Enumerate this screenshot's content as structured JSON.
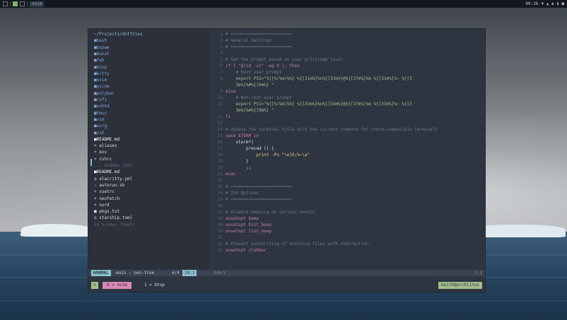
{
  "topbar": {
    "title": "nvim",
    "clock": "00:26",
    "tray": "▼ ▲ ◆ ▮ ■"
  },
  "tree": [
    {
      "text": "~/Projects/dotfiles",
      "cls": "root"
    },
    {
      "text": "  ■bash",
      "cls": "dir"
    },
    {
      "text": "  ■bspwm",
      "cls": "dir"
    },
    {
      "text": "  ■dunst",
      "cls": "dir"
    },
    {
      "text": "  ■feh",
      "cls": "dir"
    },
    {
      "text": "  ■htop",
      "cls": "dir"
    },
    {
      "text": "  ■kitty",
      "cls": "dir"
    },
    {
      "text": "  ■nvim",
      "cls": "dir"
    },
    {
      "text": "  ■picom",
      "cls": "dir"
    },
    {
      "text": "  ■polybar",
      "cls": "dir"
    },
    {
      "text": "  ■rofi",
      "cls": "dir"
    },
    {
      "text": "  ■sxhkd",
      "cls": "dir"
    },
    {
      "text": "  ■tmux",
      "cls": "dir"
    },
    {
      "text": "  ■vim",
      "cls": "dir"
    },
    {
      "text": "  ■xorg",
      "cls": "dir"
    },
    {
      "text": "  ■zsh",
      "cls": "dir"
    },
    {
      "text": "    ■README.md",
      "cls": "hl"
    },
    {
      "text": "    + aliases",
      "cls": "file"
    },
    {
      "text": "    + env",
      "cls": "file"
    },
    {
      "text": "    + zshrc",
      "cls": "file"
    },
    {
      "text": "  ... hidden (ok)",
      "cls": "dim"
    },
    {
      "text": "  ■README.md",
      "cls": "hl"
    },
    {
      "text": "  ◎ alacritty.yml",
      "cls": "file"
    },
    {
      "text": "  ◦ autorun.sh",
      "cls": "file"
    },
    {
      "text": "  + xsetrc",
      "cls": "file"
    },
    {
      "text": "  + neofetch",
      "cls": "file"
    },
    {
      "text": "  + nord",
      "cls": "file"
    },
    {
      "text": "  ■ pkgs.txt",
      "cls": "file"
    },
    {
      "text": "  ◎ starship.toml",
      "cls": "file"
    },
    {
      "text": "  14 hidden (toml)",
      "cls": "dim"
    }
  ],
  "code": [
    {
      "n": "1",
      "t": "# ========================",
      "c": "cmt"
    },
    {
      "n": "2",
      "t": "# General Settings",
      "c": "cmt"
    },
    {
      "n": "3",
      "t": "# ========================",
      "c": "cmt"
    },
    {
      "n": "4",
      "t": "",
      "c": "cmt"
    },
    {
      "n": "5",
      "t": "# Set the prompt based on user privilege level",
      "c": "cmt"
    },
    {
      "n": "6",
      "t": "if [ \"$(id -u)\" -eq 0 ]; then",
      "c": "kw"
    },
    {
      "n": "7",
      "t": "    # Root user prompt",
      "c": "cmt"
    },
    {
      "n": "8",
      "t": "    export PS1=\"%{[%(%m)%%} %{[31m%}%n%{[33m%}@%{[37m%}%m %{[33m%}%~ %{[3",
      "c": "str"
    },
    {
      "n": "",
      "t": "    3m%}%#%{[0m%} \"",
      "c": "str"
    },
    {
      "n": "9",
      "t": "else",
      "c": "kw"
    },
    {
      "n": "10",
      "t": "    # Non-root user prompt",
      "c": "cmt"
    },
    {
      "n": "11",
      "t": "    export PS1=\"%{[%(%m)%%} %{[32m%}%n%{[33m%}@%{[37m%}%m %{[33m%}%~ %{[3",
      "c": "str"
    },
    {
      "n": "",
      "t": "    3m%}%#%{[0m%} \"",
      "c": "str"
    },
    {
      "n": "12",
      "t": "fi",
      "c": "kw"
    },
    {
      "n": "13",
      "t": "",
      "c": "cmt"
    },
    {
      "n": "14",
      "t": "# Update the terminal title with the current command for xterm-compatible terminals",
      "c": "cmt"
    },
    {
      "n": "15",
      "t": "case $TERM in",
      "c": "kw"
    },
    {
      "n": "16",
      "t": "    xterm*)",
      "c": "var"
    },
    {
      "n": "17",
      "t": "        precmd () {",
      "c": "var"
    },
    {
      "n": "18",
      "t": "            print -Pn \"\\e]0;%~\\a\"",
      "c": "yel"
    },
    {
      "n": "19",
      "t": "        }",
      "c": "var"
    },
    {
      "n": "20",
      "t": "        ;;",
      "c": "var"
    },
    {
      "n": "21",
      "t": "esac",
      "c": "kw"
    },
    {
      "n": "22",
      "t": "",
      "c": "cmt"
    },
    {
      "n": "23",
      "t": "# ========================",
      "c": "cmt"
    },
    {
      "n": "24",
      "t": "# Zsh Options",
      "c": "cmt"
    },
    {
      "n": "25",
      "t": "# ========================",
      "c": "cmt"
    },
    {
      "n": "26",
      "t": "",
      "c": "cmt"
    },
    {
      "n": "27",
      "t": "# Disable beeping on various events",
      "c": "cmt"
    },
    {
      "n": "28",
      "t": "unsetopt beep",
      "c": "kw"
    },
    {
      "n": "29",
      "t": "unsetopt hist_beep",
      "c": "kw"
    },
    {
      "n": "30",
      "t": "unsetopt list_beep",
      "c": "kw"
    },
    {
      "n": "31",
      "t": "",
      "c": "cmt"
    },
    {
      "n": "32",
      "t": "# Prevent overwriting of existing files with redirection",
      "c": "cmt"
    },
    {
      "n": "33",
      "t": "unsetopt clobber",
      "c": "kw"
    }
  ],
  "status": {
    "mode": "NORMAL",
    "branch": "main · neo-tree",
    "pos": "4/4",
    "pos2": "20:1",
    "file": "zshrc",
    "right": "1:1"
  },
  "tmux": {
    "session": "s",
    "window": "0 > nvim",
    "window2": "1 > btop",
    "host": "keith@archlinux"
  }
}
